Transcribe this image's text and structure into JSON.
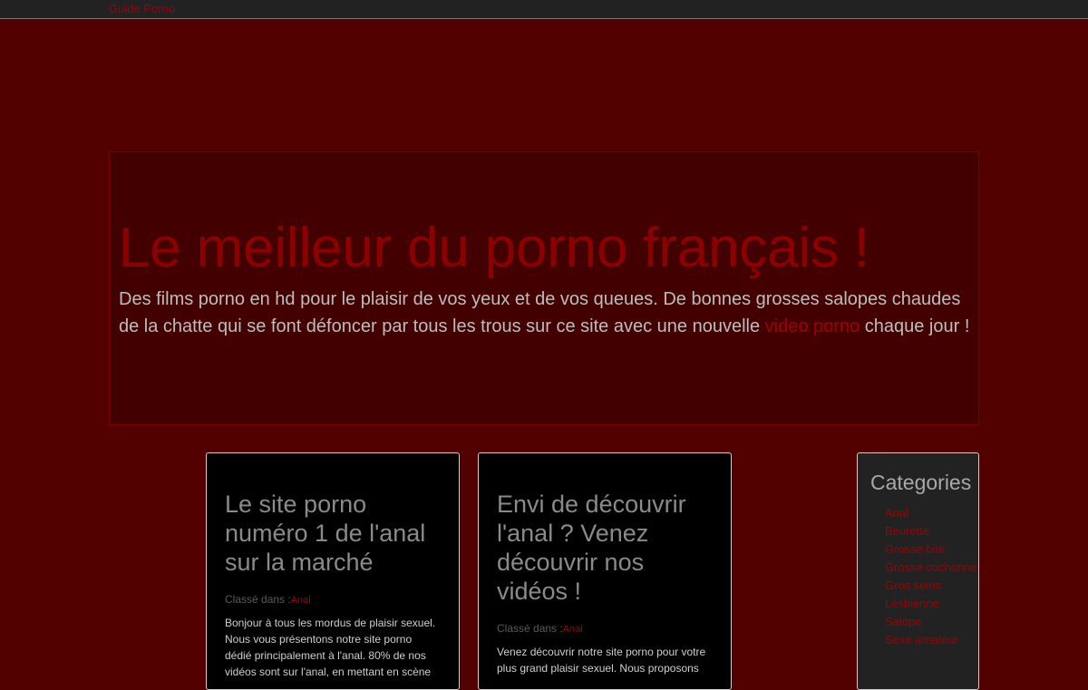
{
  "nav": {
    "brand": "Guide Porno"
  },
  "hero": {
    "title": "Le meilleur du porno français !",
    "text_before": "Des films porno en hd pour le plaisir de vos yeux et de vos queues. De bonnes grosses salopes chaudes de la chatte qui se font défoncer par tous les trous sur ce site avec une nouvelle ",
    "link": "video porno",
    "text_after": " chaque jour !"
  },
  "posts": [
    {
      "title": "Le site porno numéro 1 de l'anal sur la marché",
      "meta_label": "Classé dans :",
      "category": "Anal",
      "excerpt": "Bonjour à tous les mordus de plaisir sexuel. Nous vous présentons notre site porno dédié principalement à l'anal. 80% de nos vidéos sont sur l'anal, en mettant en scène"
    },
    {
      "title": "Envi de découvrir l'anal ? Venez découvrir nos vidéos !",
      "meta_label": "Classé dans :",
      "category": "Anal",
      "excerpt": "Venez découvrir notre site porno pour votre plus grand plaisir sexuel. Nous proposons"
    }
  ],
  "sidebar": {
    "title": "Categories",
    "items": [
      "Anal",
      "Beurette",
      "Grosse bite",
      "Grosse cochonne",
      "Gros seins",
      "Lesbienne",
      "Salope",
      "Sexe amateur"
    ]
  },
  "colors": {
    "background": "#520000",
    "accent": "#a00000",
    "topbar": "#222222"
  }
}
